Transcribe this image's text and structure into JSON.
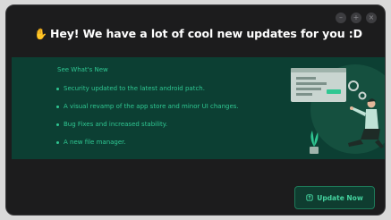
{
  "dialog": {
    "title": "Hey! We have a lot of cool new updates for you :D",
    "wave_icon": "waving-hand-icon",
    "window_controls": [
      {
        "name": "minimize-button",
        "glyph": "–"
      },
      {
        "name": "maximize-button",
        "glyph": "+"
      },
      {
        "name": "close-button",
        "glyph": "×"
      }
    ]
  },
  "banner": {
    "heading": "See What's New",
    "items": [
      "Security updated to the latest android patch.",
      "A visual revamp of the app store and minor UI changes.",
      "Bug Fixes and increased stability.",
      "A new file manager."
    ]
  },
  "actions": {
    "update_label": "Update Now",
    "update_icon": "update-icon"
  },
  "colors": {
    "background": "#1c1c1d",
    "banner": "#0c3f33",
    "accent": "#2fc792",
    "button_text": "#45d39f"
  }
}
